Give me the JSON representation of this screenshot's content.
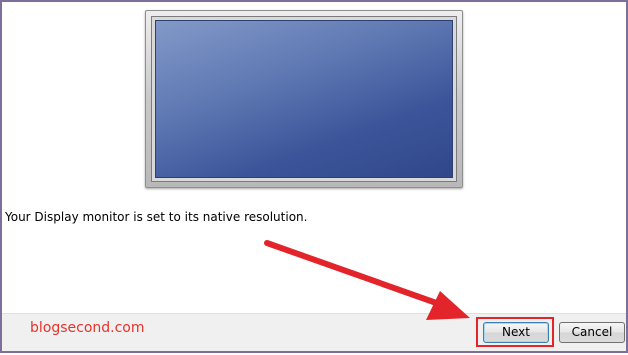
{
  "content": {
    "message": "Your Display monitor is set to its native resolution."
  },
  "footer": {
    "watermark": "blogsecond.com",
    "next_label": "Next",
    "cancel_label": "Cancel"
  },
  "colors": {
    "annotation": "#e3242b",
    "watermark": "#e8322a",
    "frame_border": "#7c6f99",
    "screen_blue": "#3c559a"
  }
}
